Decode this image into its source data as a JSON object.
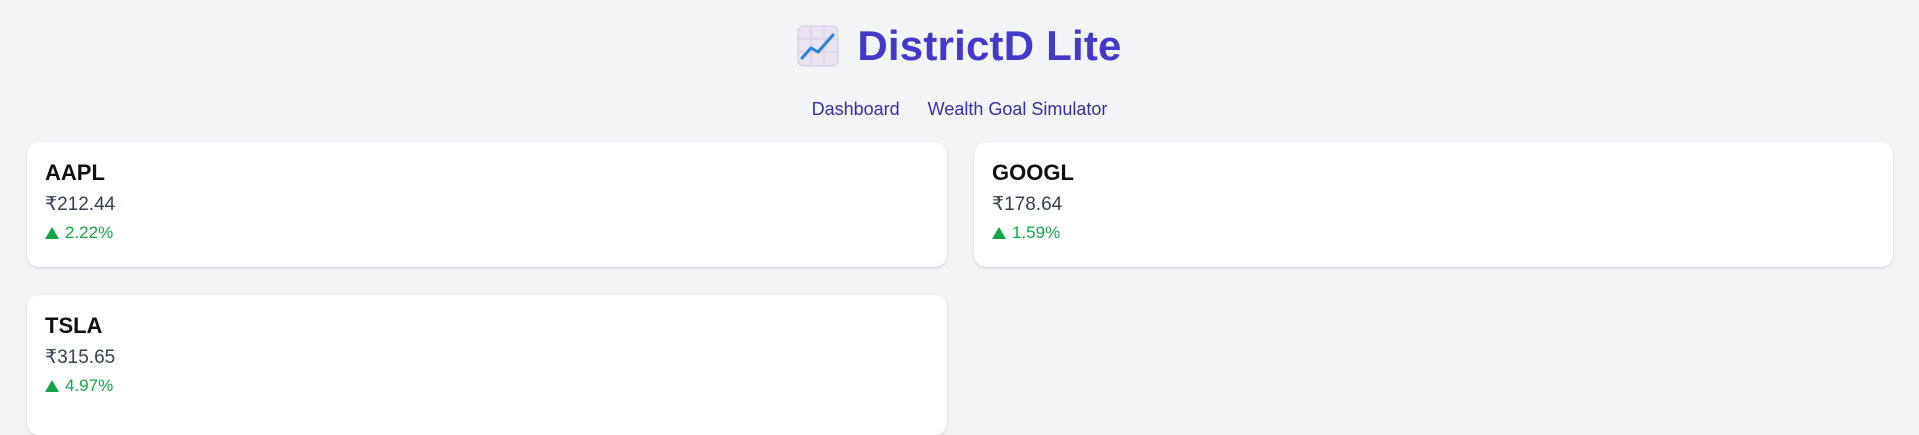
{
  "app": {
    "title": "DistrictD Lite",
    "logo_icon": "chart-increasing-icon"
  },
  "nav": {
    "items": [
      {
        "label": "Dashboard"
      },
      {
        "label": "Wealth Goal Simulator"
      }
    ]
  },
  "stocks": [
    {
      "symbol": "AAPL",
      "price": "₹212.44",
      "change": "2.22%",
      "direction": "up"
    },
    {
      "symbol": "GOOGL",
      "price": "₹178.64",
      "change": "1.59%",
      "direction": "up"
    },
    {
      "symbol": "TSLA",
      "price": "₹315.65",
      "change": "4.97%",
      "direction": "up"
    }
  ],
  "colors": {
    "accent": "#4338ca",
    "nav": "#3730a3",
    "positive": "#16a34a",
    "background": "#f3f4f6"
  }
}
